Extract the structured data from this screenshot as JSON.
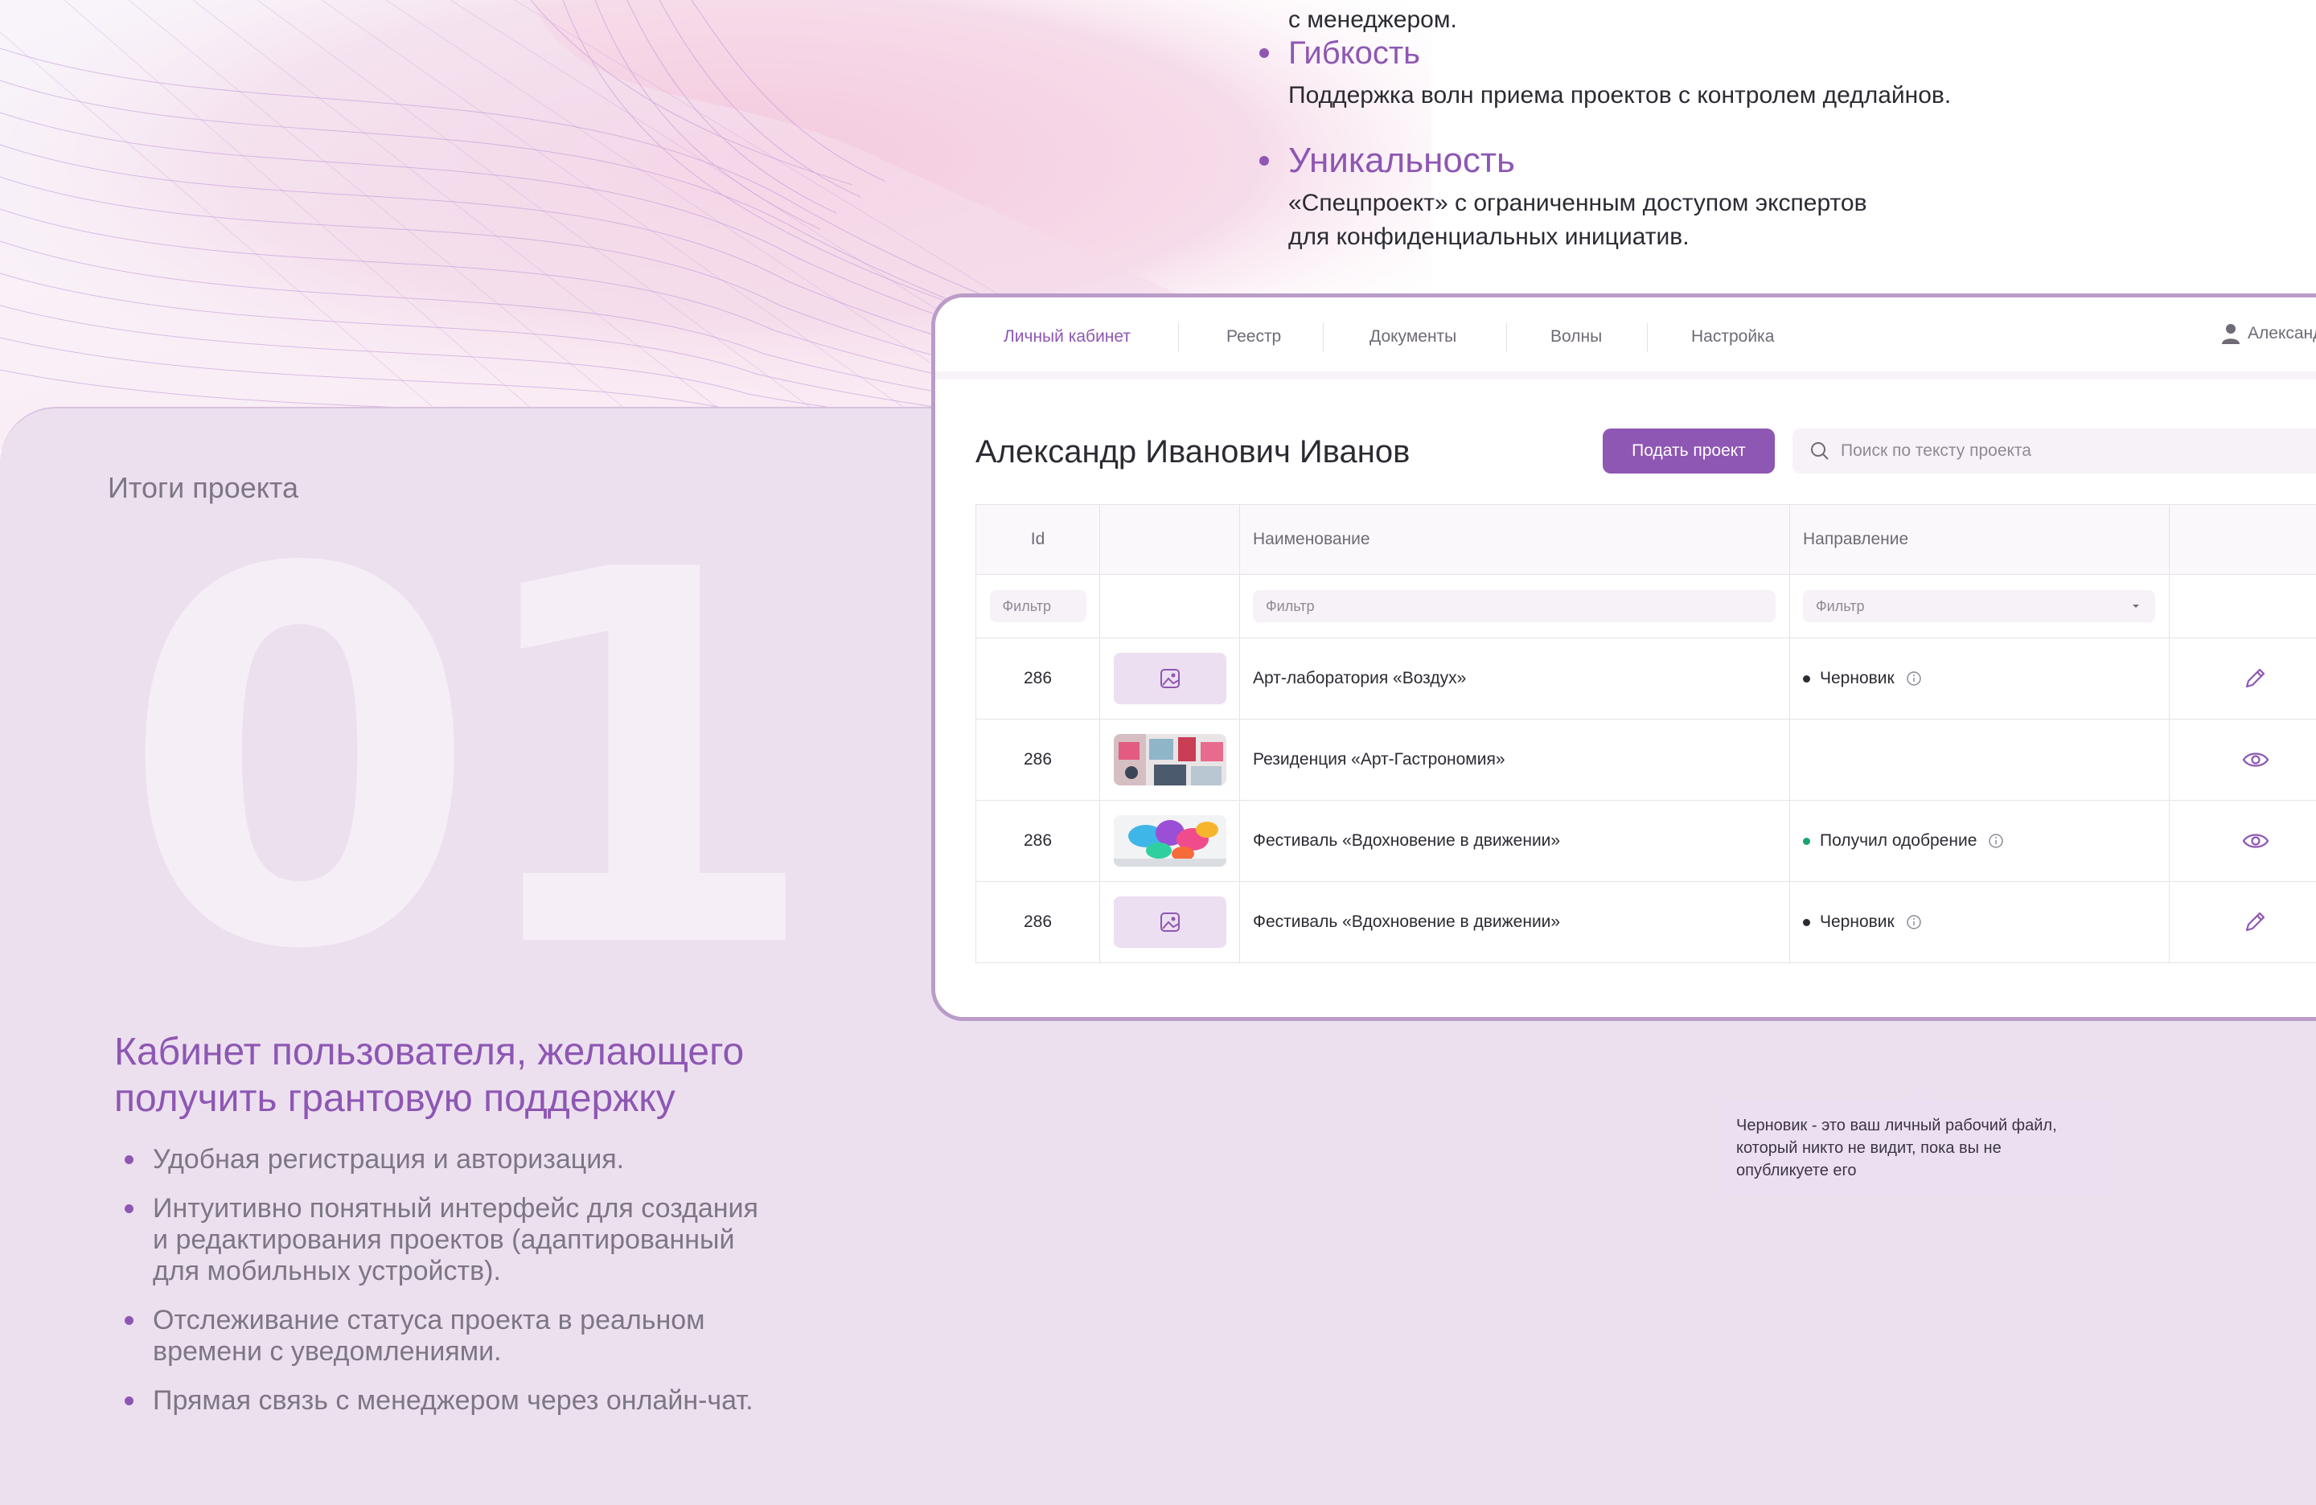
{
  "top": {
    "cut_text": "с менеджером.",
    "items": [
      {
        "title": "Гибкость",
        "text": "Поддержка волн приема проектов с контролем дедлайнов."
      },
      {
        "title": "Уникальность",
        "text_line1": "«Спецпроект» с ограниченным доступом экспертов",
        "text_line2": "для конфиденциальных инициатив."
      }
    ]
  },
  "panel": {
    "kicker": "Итоги проекта",
    "number": "01",
    "headline_line1": "Кабинет пользователя, желающего",
    "headline_line2": "получить грантовую поддержку",
    "features": [
      {
        "lines": [
          "Удобная регистрация и авторизация."
        ]
      },
      {
        "lines": [
          "Интуитивно понятный интерфейс для создания",
          "и редактирования проектов (адаптированный",
          "для мобильных устройств)."
        ]
      },
      {
        "lines": [
          "Отслеживание статуса проекта в реальном",
          "времени с уведомлениями."
        ]
      },
      {
        "lines": [
          "Прямая связь с менеджером через онлайн-чат."
        ]
      }
    ]
  },
  "app": {
    "nav": [
      "Личный кабинет",
      "Реестр",
      "Документы",
      "Волны",
      "Настройка"
    ],
    "user_name": "Александр Иванович Иванов",
    "page_title": "Александр Иванович Иванов",
    "submit_label": "Подать проект",
    "search_placeholder": "Поиск по тексту проекта",
    "columns": {
      "id": "Id",
      "image": "",
      "name": "Наименование",
      "direction": "Направление"
    },
    "filter_placeholder": "Фильтр",
    "rows": [
      {
        "id": "286",
        "image": "placeholder",
        "name": "Арт-лаборатория «Воздух»",
        "status": "Черновик",
        "status_color": "#2b2b33",
        "action": "pencil-icon"
      },
      {
        "id": "286",
        "image": "photo-gallery",
        "name": "Резиденция «Арт-Гастрономия»",
        "status": "",
        "status_color": "#2b2b33",
        "action": "eye-icon"
      },
      {
        "id": "286",
        "image": "photo-paint",
        "name": "Фестиваль «Вдохновение в движении»",
        "status": "Получил одобрение",
        "status_color": "#1ba36e",
        "action": "eye-icon"
      },
      {
        "id": "286",
        "image": "placeholder",
        "name": "Фестиваль «Вдохновение в движении»",
        "status": "Черновик",
        "status_color": "#2b2b33",
        "action": "pencil-icon"
      }
    ],
    "tooltip": {
      "line1": "Черновик - это ваш личный рабочий файл,",
      "line2": "который никто не видит, пока вы не",
      "line3": "опубликуете его"
    }
  },
  "colors": {
    "accent": "#8e57b3",
    "panel_bg": "#ece0ef",
    "approved": "#1ba36e",
    "border": "#b99cc8"
  }
}
